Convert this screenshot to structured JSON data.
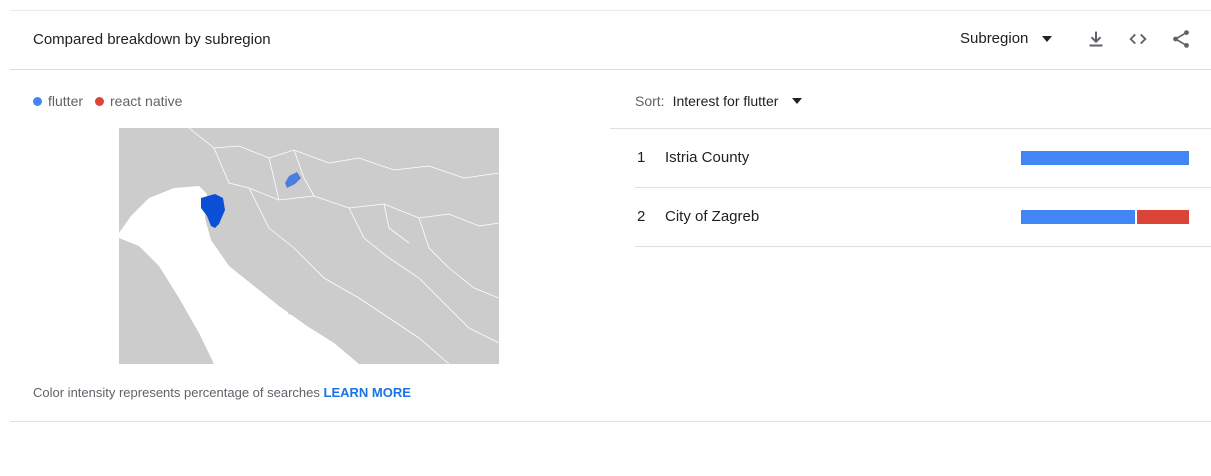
{
  "header": {
    "title": "Compared breakdown by subregion",
    "resolution_select": "Subregion"
  },
  "legend": [
    {
      "label": "flutter",
      "color": "#4285f4"
    },
    {
      "label": "react native",
      "color": "#db4437"
    }
  ],
  "footnote": {
    "text": "Color intensity represents percentage of searches ",
    "link": "LEARN MORE"
  },
  "sort": {
    "label": "Sort:",
    "value": "Interest for flutter"
  },
  "rows": [
    {
      "rank": "1",
      "name": "Istria County",
      "flutter_share": 1.0,
      "react_share": 0.0
    },
    {
      "rank": "2",
      "name": "City of Zagreb",
      "flutter_share": 0.69,
      "react_share": 0.31
    }
  ],
  "colors": {
    "flutter": "#4285f4",
    "react_native": "#db4437",
    "link": "#1a73e8"
  },
  "icons": [
    "chevron-down-icon",
    "download-icon",
    "embed-icon",
    "share-icon"
  ]
}
